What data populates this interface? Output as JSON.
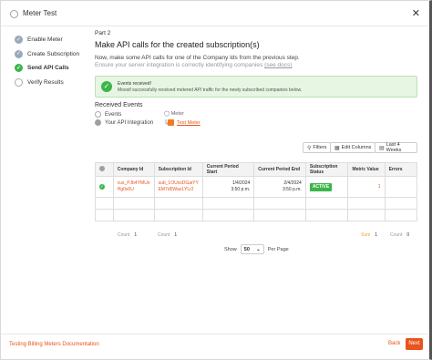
{
  "window": {
    "title": "Meter Test",
    "title_icon": "meter-icon",
    "close_icon": "close-icon"
  },
  "steps": [
    {
      "label": "Enable Meter",
      "state": "done"
    },
    {
      "label": "Create Subscription",
      "state": "done"
    },
    {
      "label": "Send API Calls",
      "state": "current"
    },
    {
      "label": "Verify Results",
      "state": "todo"
    }
  ],
  "main": {
    "part": "Part 2",
    "heading": "Make API calls for the created subscription(s)",
    "description": "Now, make some API calls for one of the Company Ids from the previous step.",
    "description2": "Ensure your server integration is correctly identifying companies",
    "docs_link": "(see docs)"
  },
  "alert": {
    "title": "Events received!",
    "body": "Moesif successfully received metered API traffic for the newly subscribed companies below.",
    "color": "#3cb54a"
  },
  "received": {
    "title": "Received Events",
    "options": [
      "Events",
      "Your API Integration"
    ],
    "meter_label": "Meter",
    "test_meter": "Test Meter"
  },
  "toolbar": {
    "filters": "Filters",
    "edit_columns": "Edit Columns",
    "time_range": "Last 4 Weeks"
  },
  "table": {
    "columns": [
      "Company Id",
      "Subscription Id",
      "Current Period Start",
      "Current Period End",
      "Subscription Status",
      "Metric Value",
      "Errors"
    ],
    "rows": [
      {
        "company_id_1": "cus_PJb4YMUo",
        "company_id_2": "Hg0s6U",
        "subscription_id_1": "sub_1OUxsDGaiYY",
        "subscription_id_2": "EM7d5Wax1YLr2",
        "start_date": "1/4/2024",
        "start_time": "3:50 p.m.",
        "end_date": "2/4/2024",
        "end_time": "3:50 p.m.",
        "status": "ACTIVE",
        "metric_value": "1",
        "errors": ""
      }
    ]
  },
  "stats": [
    {
      "label": "Count",
      "value": "1"
    },
    {
      "label": "Count",
      "value": "1"
    },
    {
      "label": "Sum",
      "value": "1"
    },
    {
      "label": "Count",
      "value": "0"
    }
  ],
  "pager": {
    "show_label": "Show",
    "page_size": "50",
    "per_page": "Per Page"
  },
  "footer": {
    "doc_link": "Testing Billing Meters Documentation",
    "back": "Back",
    "next": "Next"
  },
  "colors": {
    "accent": "#e8541c",
    "success": "#3cb54a"
  }
}
